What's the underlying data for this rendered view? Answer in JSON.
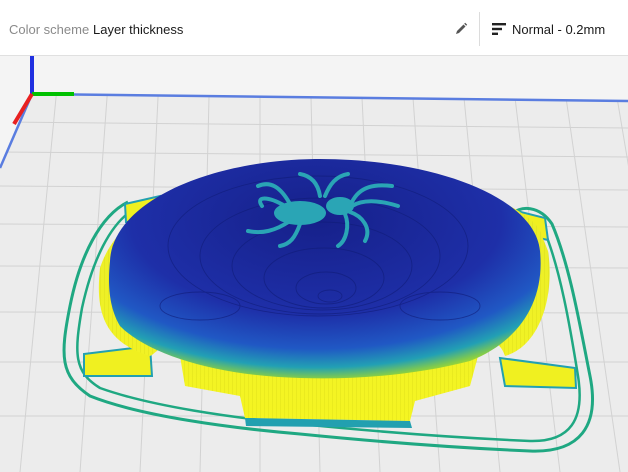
{
  "toolbar": {
    "color_scheme_label": "Color scheme",
    "color_scheme_value": "Layer thickness",
    "edit_icon": "pencil-icon",
    "profile_icon": "print-settings-icon",
    "profile_label": "Normal - 0.2mm"
  },
  "viewport": {
    "background": "#f4f4f4",
    "build_plate_color": "#ececec",
    "grid_line_color": "#cfcfcf",
    "plate_border_color": "#4a6fd8",
    "axis_colors": {
      "x": "#e82020",
      "y": "#00c000",
      "z": "#2030e0"
    },
    "skirt_color": "#1fa882",
    "layer_color_gradient": [
      "#1e2fa0",
      "#2060c0",
      "#22a0b0",
      "#88d040",
      "#f0f020"
    ]
  }
}
